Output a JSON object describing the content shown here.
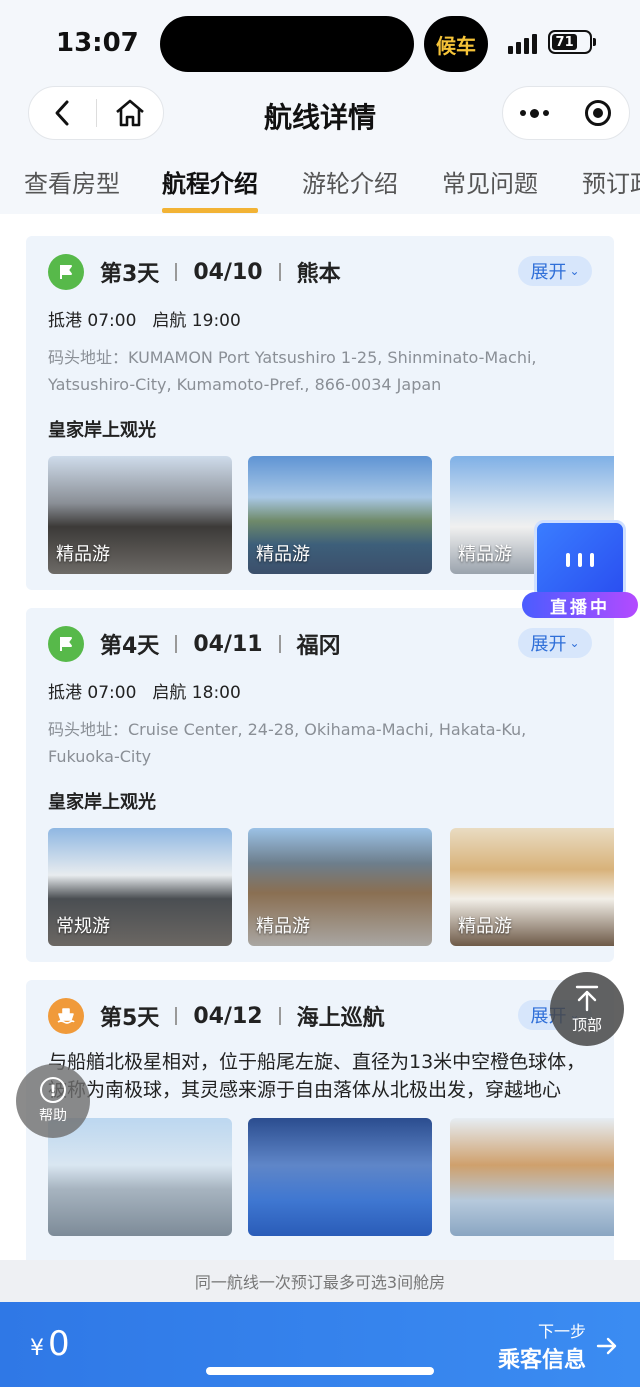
{
  "status_bar": {
    "time": "13:07",
    "houche": "候车",
    "battery": "71"
  },
  "nav": {
    "title": "航线详情"
  },
  "tabs": [
    {
      "label": "查看房型",
      "active": false
    },
    {
      "label": "航程介绍",
      "active": true
    },
    {
      "label": "游轮介绍",
      "active": false
    },
    {
      "label": "常见问题",
      "active": false
    },
    {
      "label": "预订政",
      "active": false
    }
  ],
  "days": [
    {
      "label": "第3天",
      "date": "04/10",
      "place": "熊本",
      "icon": "flag-icon",
      "expand": "展开",
      "arrive": "抵港 07:00",
      "depart": "启航 19:00",
      "address": "码头地址：KUMAMON Port Yatsushiro  1-25, Shinminato-Machi, Yatsushiro-City, Kumamoto-Pref., 866-0034 Japan",
      "section": "皇家岸上观光",
      "photos": [
        "精品游",
        "精品游",
        "精品游"
      ]
    },
    {
      "label": "第4天",
      "date": "04/11",
      "place": "福冈",
      "icon": "flag-icon",
      "expand": "展开",
      "arrive": "抵港 07:00",
      "depart": "启航 18:00",
      "address": "码头地址：Cruise Center, 24-28, Okihama-Machi, Hakata-Ku, Fukuoka-City",
      "section": "皇家岸上观光",
      "photos": [
        "常规游",
        "精品游",
        "精品游"
      ]
    },
    {
      "label": "第5天",
      "date": "04/12",
      "place": "海上巡航",
      "icon": "ship-icon",
      "expand": "展开",
      "desc": "与船艏北极星相对，位于船尾左旋、直径为13米中空橙色球体，被称为南极球，其灵感来源于自由落体从北极出发，穿越地心最...",
      "photos": [
        "",
        "",
        ""
      ]
    }
  ],
  "floating": {
    "live": "直播中",
    "top": "顶部",
    "help": "帮助"
  },
  "notice": "同一航线一次预订最多可选3间舱房",
  "bottom": {
    "currency": "¥",
    "price": "0",
    "next_small": "下一步",
    "next_big": "乘客信息"
  }
}
